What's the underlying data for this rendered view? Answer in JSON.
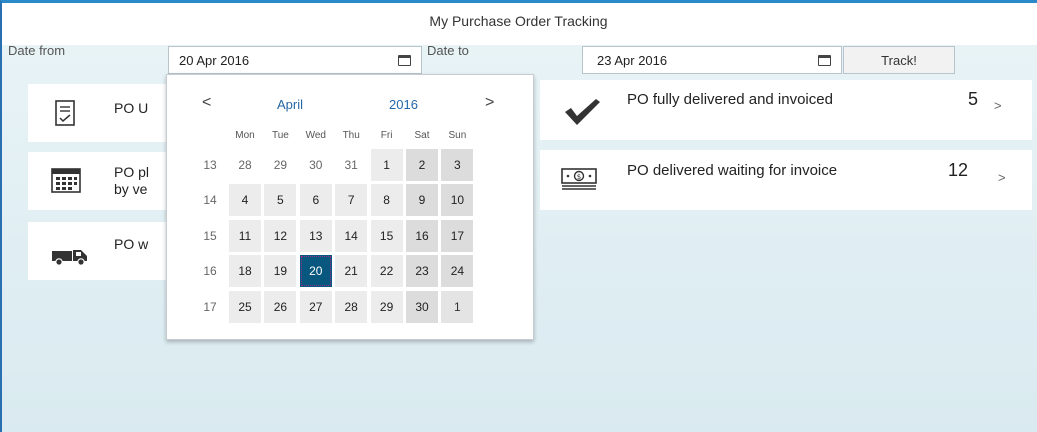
{
  "app": {
    "title": "My Purchase Order Tracking"
  },
  "filters": {
    "date_from_label": "Date from",
    "date_from_value": "20 Apr 2016",
    "date_to_label": "Date to",
    "date_to_value": "23 Apr 2016",
    "track_button": "Track!"
  },
  "tiles": [
    {
      "label": "PO U",
      "icon": "document-check-icon"
    },
    {
      "label": "PO pl",
      "label2": "by ve",
      "icon": "calendar-grid-icon"
    },
    {
      "label": "PO w",
      "icon": "truck-icon"
    },
    {
      "label": "PO fully delivered and invoiced",
      "count": "5",
      "icon": "checkmark-icon"
    },
    {
      "label": "PO delivered waiting for invoice",
      "count": "12",
      "icon": "money-icon"
    }
  ],
  "calendar": {
    "month": "April",
    "year": "2016",
    "prev": "<",
    "next": ">",
    "weekdays": [
      "Mon",
      "Tue",
      "Wed",
      "Thu",
      "Fri",
      "Sat",
      "Sun"
    ],
    "weeks": [
      {
        "num": "13",
        "days": [
          "28",
          "29",
          "30",
          "31",
          "1",
          "2",
          "3"
        ]
      },
      {
        "num": "14",
        "days": [
          "4",
          "5",
          "6",
          "7",
          "8",
          "9",
          "10"
        ]
      },
      {
        "num": "15",
        "days": [
          "11",
          "12",
          "13",
          "14",
          "15",
          "16",
          "17"
        ]
      },
      {
        "num": "16",
        "days": [
          "18",
          "19",
          "20",
          "21",
          "22",
          "23",
          "24"
        ]
      },
      {
        "num": "17",
        "days": [
          "25",
          "26",
          "27",
          "28",
          "29",
          "30",
          "1"
        ]
      }
    ],
    "selected_day": "20"
  }
}
